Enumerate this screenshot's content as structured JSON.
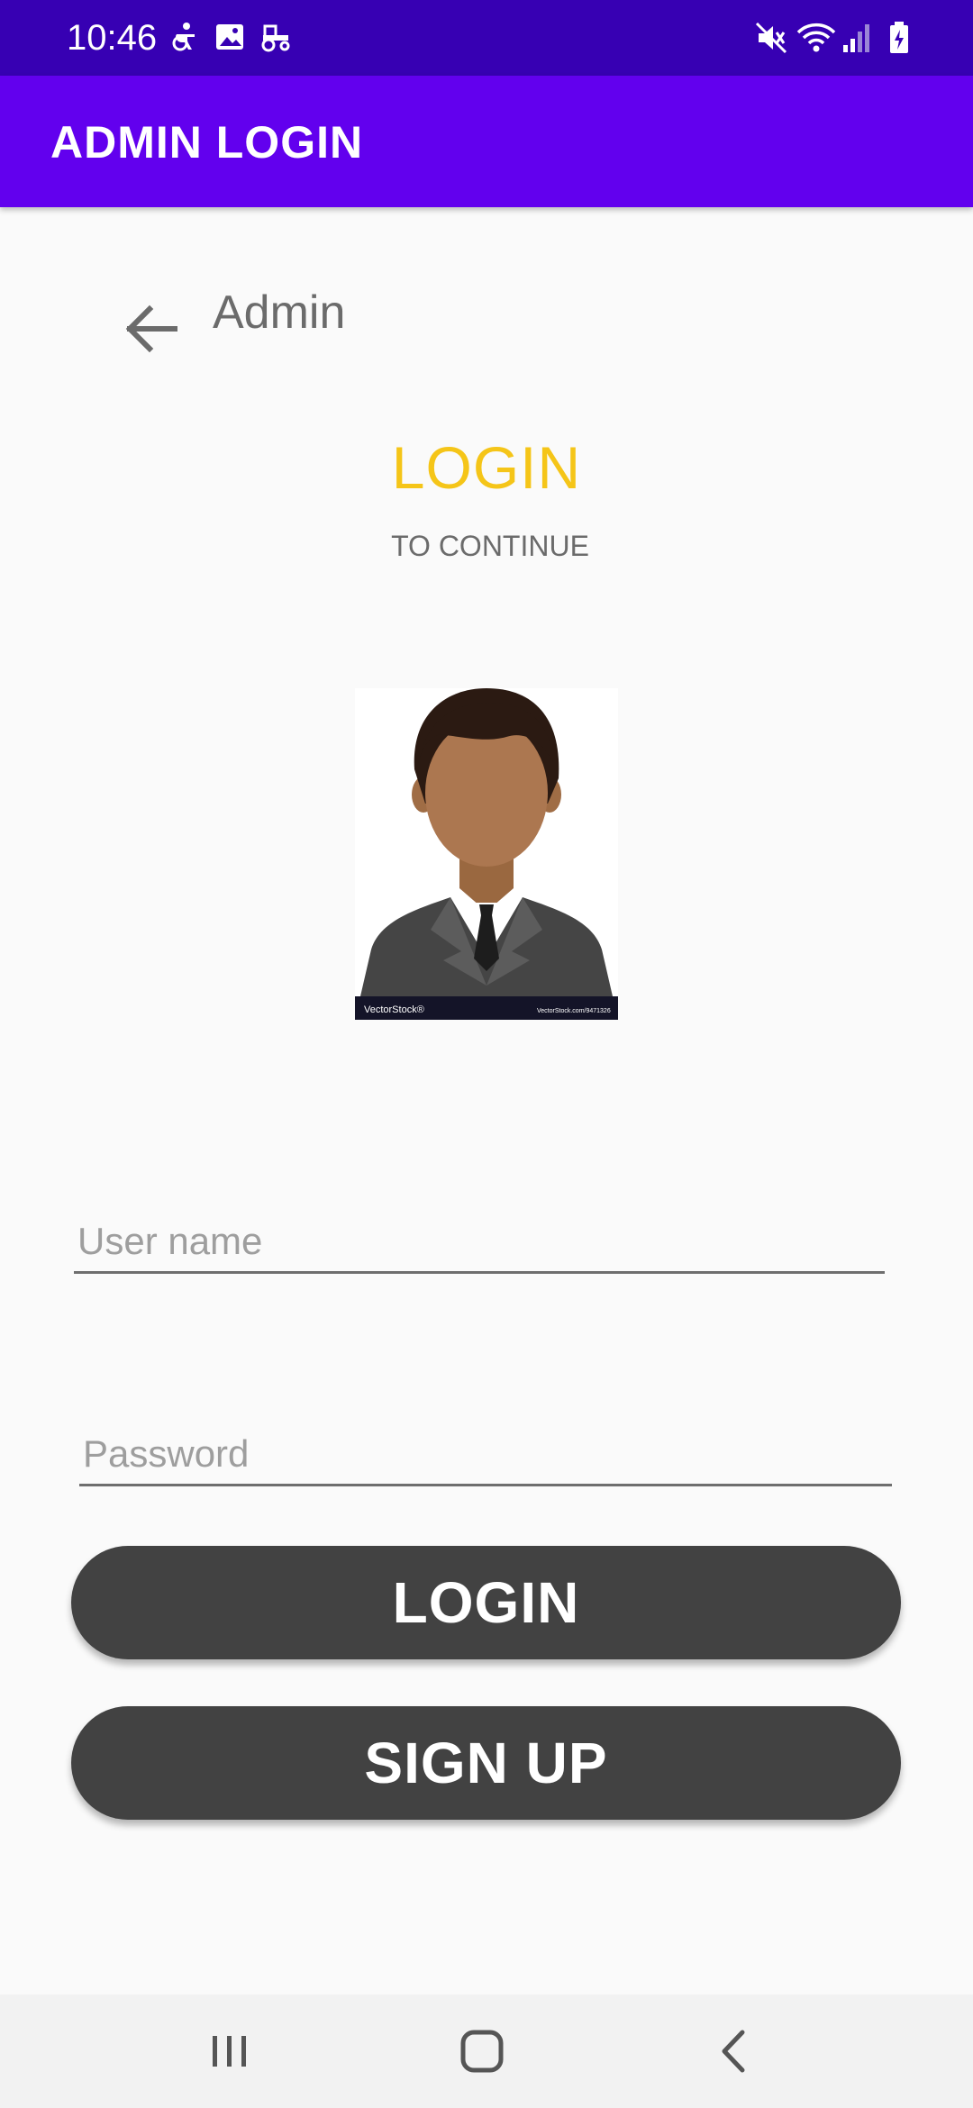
{
  "status_bar": {
    "time": "10:46",
    "icons": [
      "accessibility-icon",
      "gallery-icon",
      "tractor-icon",
      "mute-icon",
      "wifi-icon",
      "signal-icon",
      "battery-charging-icon"
    ]
  },
  "app_bar": {
    "title": "ADMIN LOGIN",
    "color": "#6200ee"
  },
  "back_row": {
    "icon": "arrow-left-icon",
    "label": "Admin"
  },
  "heading": {
    "title": "LOGIN",
    "subtitle": "TO CONTINUE",
    "title_color": "#f5c518"
  },
  "avatar": {
    "description_icon": "user-avatar-icon",
    "watermark_left": "VectorStock®",
    "watermark_right": "VectorStock.com/9471326"
  },
  "form": {
    "username_placeholder": "User name",
    "username_value": "",
    "password_placeholder": "Password",
    "password_value": ""
  },
  "buttons": {
    "login_label": "LOGIN",
    "signup_label": "SIGN UP",
    "color": "#424242"
  },
  "nav_bar": {
    "icons": [
      "recent-apps-icon",
      "home-icon",
      "back-icon"
    ]
  }
}
